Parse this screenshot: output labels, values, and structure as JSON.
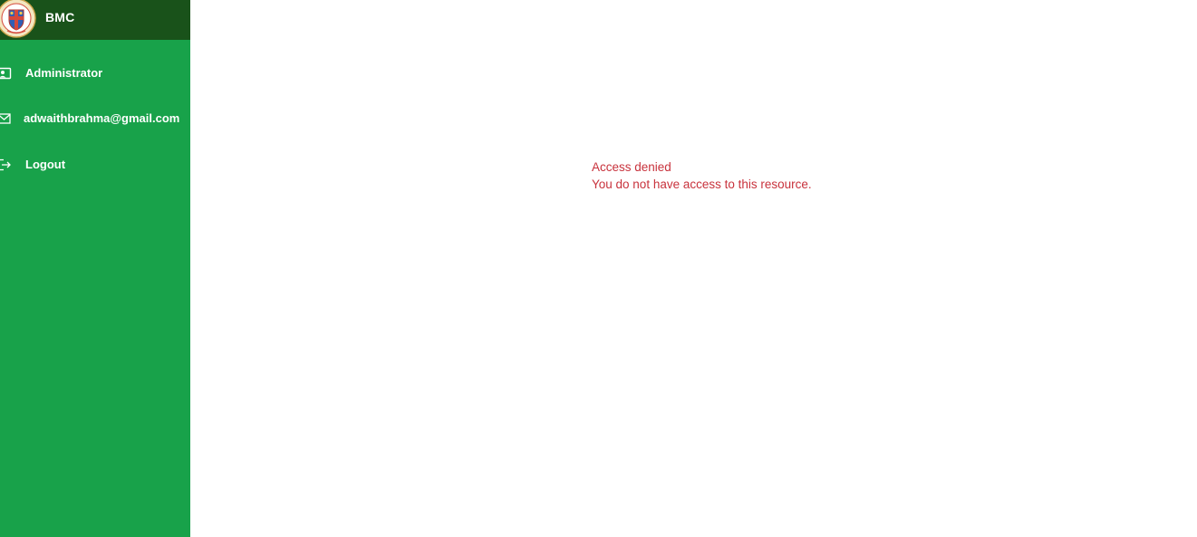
{
  "brand": {
    "name": "BMC",
    "logo_icon": "bmc-emblem-icon"
  },
  "sidebar": {
    "items": [
      {
        "label": "Administrator",
        "icon": "user-card-icon"
      },
      {
        "label": "adwaithbrahma@gmail.com",
        "icon": "envelope-icon"
      },
      {
        "label": "Logout",
        "icon": "logout-icon"
      }
    ]
  },
  "main": {
    "alert": {
      "title": "Access denied",
      "message": "You do not have access to this resource."
    }
  },
  "colors": {
    "sidebar_bg": "#18a24a",
    "brand_bar_bg": "#19521a",
    "alert_text": "#c8323c"
  }
}
